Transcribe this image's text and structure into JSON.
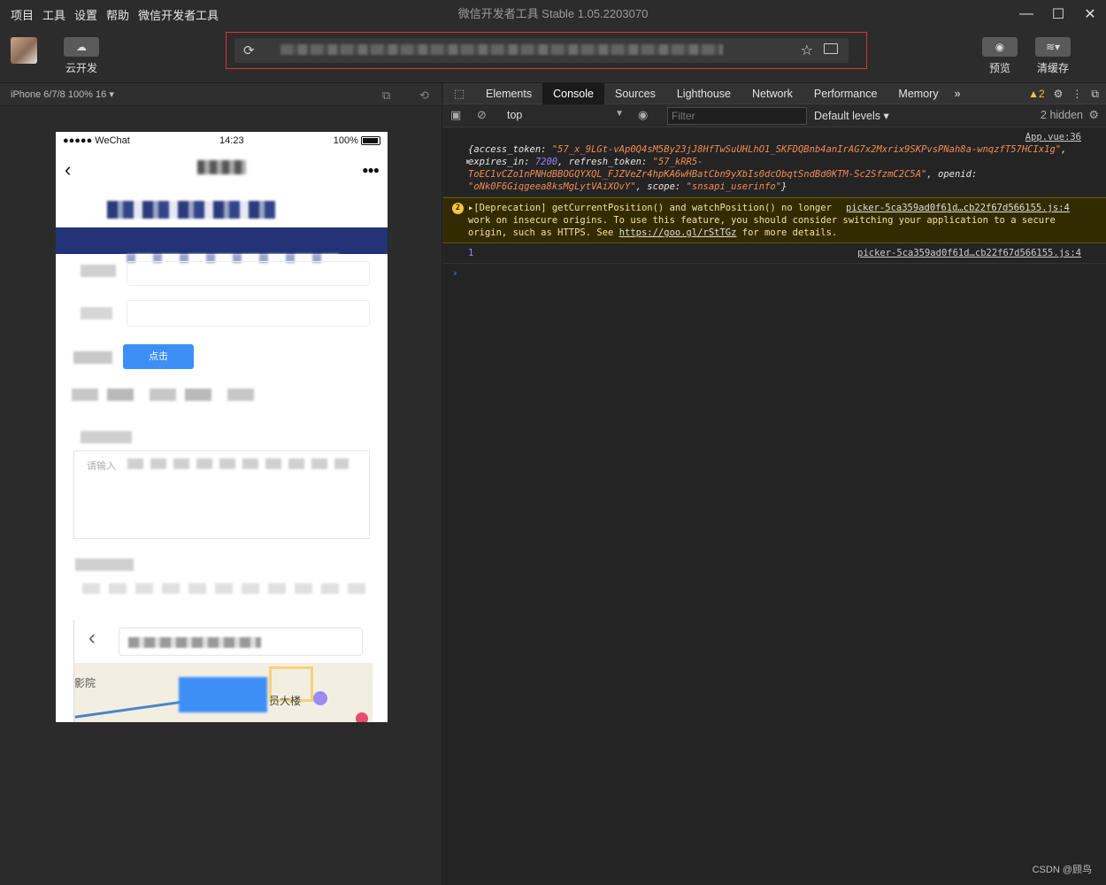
{
  "menu": [
    "项目",
    "工具",
    "设置",
    "帮助",
    "微信开发者工具"
  ],
  "window_title": "微信开发者工具 Stable 1.05.2203070",
  "window_controls": {
    "minimize": "—",
    "maximize": "☐",
    "close": "✕"
  },
  "toolbar": {
    "cloud_label": "云开发",
    "preview_label": "预览",
    "clear_cache_label": "清缓存"
  },
  "simulator": {
    "device": "iPhone 6/7/8 100% 16",
    "status_carrier": "●●●●● WeChat",
    "status_time": "14:23",
    "status_battery": "100%",
    "nav_back": "‹",
    "visible_fragments": {
      "btn": "点击",
      "placeholder": "请输入",
      "map_label": "员大楼",
      "map_left": "影院"
    }
  },
  "devtools": {
    "tabs": [
      "Elements",
      "Console",
      "Sources",
      "Lighthouse",
      "Network",
      "Performance",
      "Memory"
    ],
    "active_tab": "Console",
    "more_tabs": "»",
    "warning_count": "2",
    "context": "top",
    "filter_placeholder": "Filter",
    "levels": "Default levels ▾",
    "hidden": "2 hidden",
    "logs": {
      "log1_source": "App.vue:36",
      "log1_prefix": "{access_token: ",
      "log1_token": "\"57_x_9LGt-vAp0Q4sM5By23jJ8HfTwSuUHLhO1_SKFDQBnb4anIrAG7x2Mxrix9SKPvsPNah8a-wnqzfT57HCIx1g\"",
      "log1_expires_key": ", expires_in: ",
      "log1_expires": "7200",
      "log1_refresh_key": ", refresh_token: ",
      "log1_refresh": "\"57_kRR5-ToEC1vCZo1nPNHdBBOGQYXQL_FJZVeZr4hpKA6wHBatCbn9yXbIs0dcObqtSndBd0KTM-Sc2SfzmC2C5A\"",
      "log1_openid_key": ", openid: ",
      "log1_openid": "\"oNk0F6Giqgeea8ksMgLytVAiXOvY\"",
      "log1_scope_key": ", scope: ",
      "log1_scope": "\"snsapi_userinfo\"",
      "log1_close": "}",
      "warn_count": "2",
      "warn_source": "picker-5ca359ad0f61d…cb22f67d566155.js:4",
      "warn_text": "▸[Deprecation] getCurrentPosition() and watchPosition() no longer work on insecure origins. To use this feature, you should consider switching your application to a secure origin, such as HTTPS. See ",
      "warn_link": "https://goo.gl/rStTGz",
      "warn_tail": " for more details.",
      "log3_value": "1",
      "log3_source": "picker-5ca359ad0f61d…cb22f67d566155.js:4"
    }
  },
  "watermark": "CSDN @顾鸟"
}
